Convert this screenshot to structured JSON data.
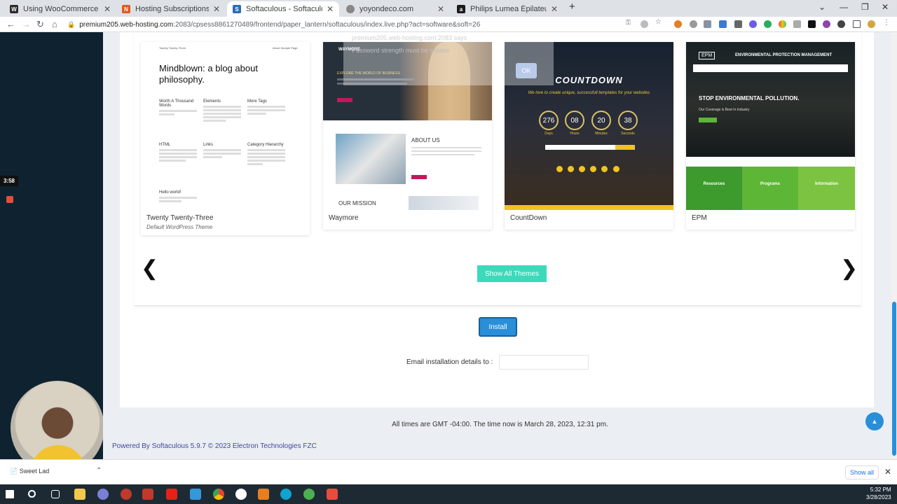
{
  "browser": {
    "tabs": [
      {
        "title": "Using WooCommerce on Local E",
        "fav": "W",
        "favcolor": "#2b2b2b"
      },
      {
        "title": "Hosting Subscriptions",
        "fav": "N",
        "favcolor": "#e25822"
      },
      {
        "title": "Softaculous - Softaculous - Word",
        "fav": "S",
        "favcolor": "#2a6db0"
      },
      {
        "title": "yoyondeco.com",
        "fav": "",
        "favcolor": "#888888"
      },
      {
        "title": "Philips Lumea Épilateur à lumièr",
        "fav": "a",
        "favcolor": "#1b1b1b"
      }
    ],
    "url_host": "premium205.web-hosting.com",
    "url_rest": ":2083/cpsess8861270489/frontend/paper_lantern/softaculous/index.live.php?act=software&soft=26"
  },
  "recording": {
    "timer": "3:58"
  },
  "alert": {
    "origin": "premium205.web-hosting.com:2083 says",
    "message": "Password strength must be greater",
    "ok": "OK"
  },
  "themes": [
    {
      "name": "Twenty Twenty-Three",
      "subtitle": "Default WordPress Theme"
    },
    {
      "name": "Waymore",
      "subtitle": ""
    },
    {
      "name": "CountDown",
      "subtitle": ""
    },
    {
      "name": "EPM",
      "subtitle": ""
    }
  ],
  "thumb1": {
    "header_left": "Twenty Twenty-Three",
    "header_right": "About  Sample Page",
    "headline": "Mindblown: a blog about philosophy.",
    "posts": [
      "Worth A Thousand Words",
      "Elements",
      "More Tags",
      "HTML",
      "Links",
      "Category Hierarchy"
    ],
    "footer_post": "Hello world!"
  },
  "thumb2": {
    "brand": "WAYMORE",
    "hero_text": "EXPLORE THE WORLD OF BUSINESS",
    "about": "ABOUT US",
    "mission": "OUR MISSION"
  },
  "thumb3": {
    "title": "COUNTDOWN",
    "tagline": "We love to create unique, successfull templates for your websites",
    "counters": [
      {
        "value": "276",
        "label": "Days"
      },
      {
        "value": "08",
        "label": "Hours"
      },
      {
        "value": "20",
        "label": "Minutes"
      },
      {
        "value": "38",
        "label": "Seconds"
      }
    ]
  },
  "thumb4": {
    "logo": "EPM",
    "title": "ENVIRONMENTAL PROTECTION MANAGEMENT",
    "headline": "STOP ENVIRONMENTAL POLLUTION.",
    "sub": "Our Coverage is Best In Industry",
    "columns": [
      "Resources",
      "Programs",
      "Information"
    ]
  },
  "buttons": {
    "show_all_themes": "Show All Themes",
    "install": "Install"
  },
  "email_label": "Email installation details to :",
  "gmt_text": "All times are GMT -04:00. The time now is March 28, 2023, 12:31 pm.",
  "powered_by": "Powered By Softaculous 5.9.7 © 2023 Electron Technologies FZC",
  "download_bar": {
    "item": "Sweet Lad",
    "show_all": "Show all"
  },
  "taskbar": {
    "time": "5:32 PM",
    "date": "3/28/2023"
  },
  "colors": {
    "show_all_bg": "#3dd9bb",
    "install_bg": "#2a8fd9",
    "link": "#3e4a9e",
    "epm_green": "#5eb636"
  }
}
